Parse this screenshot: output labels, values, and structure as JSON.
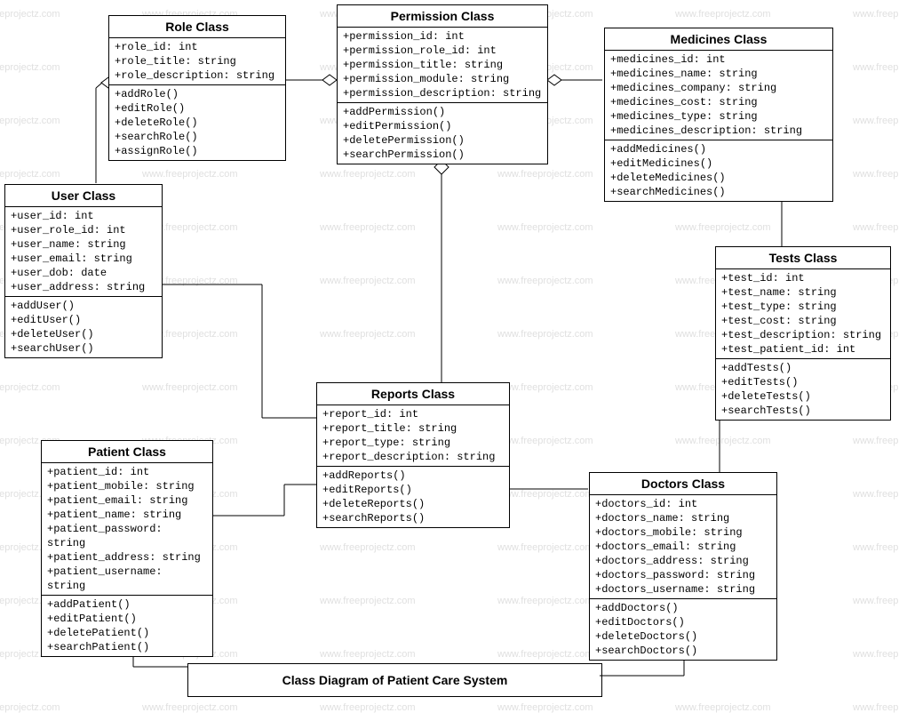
{
  "title": "Class Diagram of Patient Care System",
  "watermark_text": "www.freeprojectz.com",
  "classes": {
    "role": {
      "name": "Role Class",
      "attrs": [
        "+role_id: int",
        "+role_title: string",
        "+role_description: string"
      ],
      "ops": [
        "+addRole()",
        "+editRole()",
        "+deleteRole()",
        "+searchRole()",
        "+assignRole()"
      ]
    },
    "permission": {
      "name": "Permission Class",
      "attrs": [
        "+permission_id: int",
        "+permission_role_id: int",
        "+permission_title: string",
        "+permission_module: string",
        "+permission_description: string"
      ],
      "ops": [
        "+addPermission()",
        "+editPermission()",
        "+deletePermission()",
        "+searchPermission()"
      ]
    },
    "medicines": {
      "name": "Medicines Class",
      "attrs": [
        "+medicines_id: int",
        "+medicines_name: string",
        "+medicines_company: string",
        "+medicines_cost: string",
        "+medicines_type: string",
        "+medicines_description: string"
      ],
      "ops": [
        "+addMedicines()",
        "+editMedicines()",
        "+deleteMedicines()",
        "+searchMedicines()"
      ]
    },
    "user": {
      "name": "User Class",
      "attrs": [
        "+user_id: int",
        "+user_role_id: int",
        "+user_name: string",
        "+user_email: string",
        "+user_dob: date",
        "+user_address: string"
      ],
      "ops": [
        "+addUser()",
        "+editUser()",
        "+deleteUser()",
        "+searchUser()"
      ]
    },
    "tests": {
      "name": "Tests Class",
      "attrs": [
        "+test_id: int",
        "+test_name: string",
        "+test_type: string",
        "+test_cost: string",
        "+test_description: string",
        "+test_patient_id: int"
      ],
      "ops": [
        "+addTests()",
        "+editTests()",
        "+deleteTests()",
        "+searchTests()"
      ]
    },
    "reports": {
      "name": "Reports Class",
      "attrs": [
        "+report_id: int",
        "+report_title: string",
        "+report_type: string",
        "+report_description: string"
      ],
      "ops": [
        "+addReports()",
        "+editReports()",
        "+deleteReports()",
        "+searchReports()"
      ]
    },
    "patient": {
      "name": "Patient Class",
      "attrs": [
        "+patient_id: int",
        "+patient_mobile: string",
        "+patient_email: string",
        "+patient_name: string",
        "+patient_password: string",
        "+patient_address: string",
        "+patient_username: string"
      ],
      "ops": [
        "+addPatient()",
        "+editPatient()",
        "+deletePatient()",
        "+searchPatient()"
      ]
    },
    "doctors": {
      "name": "Doctors Class",
      "attrs": [
        "+doctors_id: int",
        "+doctors_name: string",
        "+doctors_mobile: string",
        "+doctors_email: string",
        "+doctors_address: string",
        "+doctors_password: string",
        "+doctors_username: string"
      ],
      "ops": [
        "+addDoctors()",
        "+editDoctors()",
        "+deleteDoctors()",
        "+searchDoctors()"
      ]
    }
  }
}
